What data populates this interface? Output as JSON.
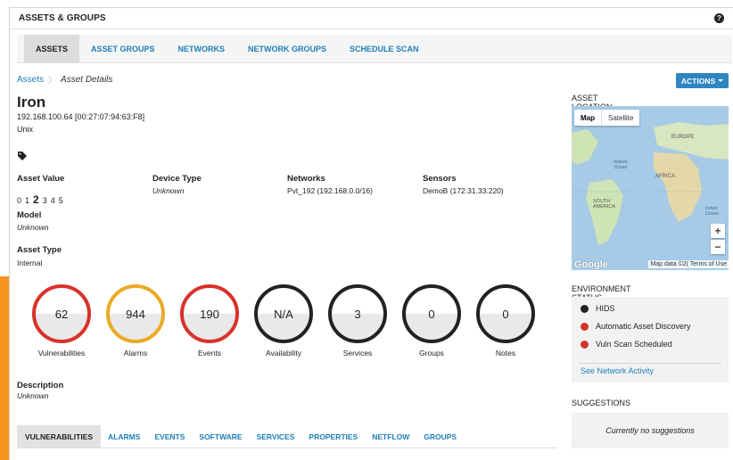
{
  "header": {
    "title": "ASSETS & GROUPS",
    "help_glyph": "?"
  },
  "tabs": [
    {
      "label": "ASSETS",
      "active": true
    },
    {
      "label": "ASSET GROUPS",
      "active": false
    },
    {
      "label": "NETWORKS",
      "active": false
    },
    {
      "label": "NETWORK GROUPS",
      "active": false
    },
    {
      "label": "SCHEDULE SCAN",
      "active": false
    }
  ],
  "breadcrumb": {
    "root": "Assets",
    "separator": "〉",
    "current": "Asset Details"
  },
  "actions": {
    "label": "ACTIONS"
  },
  "asset": {
    "name": "Iron",
    "ip_mac": "192.168.100.64 [00:27:07:94:63:F8]",
    "os": "Unix",
    "tag_icon": "tag-icon"
  },
  "fields": {
    "asset_value": {
      "label": "Asset Value",
      "scale": [
        "0",
        "1",
        "2",
        "3",
        "4",
        "5"
      ],
      "selected": "2"
    },
    "device_type": {
      "label": "Device Type",
      "value": "Unknown"
    },
    "networks": {
      "label": "Networks",
      "value": "Pvt_192 (192.168.0.0/16)"
    },
    "sensors": {
      "label": "Sensors",
      "value": "DemoB (172.31.33.220)"
    },
    "model": {
      "label": "Model",
      "value": "Unknown"
    },
    "asset_type": {
      "label": "Asset Type",
      "value": "Internal"
    }
  },
  "metrics": [
    {
      "value": "62",
      "label": "Vulnerabilities",
      "color": "#d9322b"
    },
    {
      "value": "944",
      "label": "Alarms",
      "color": "#eaaa25"
    },
    {
      "value": "190",
      "label": "Events",
      "color": "#d9322b"
    },
    {
      "value": "N/A",
      "label": "Availability",
      "color": "#222222"
    },
    {
      "value": "3",
      "label": "Services",
      "color": "#222222"
    },
    {
      "value": "0",
      "label": "Groups",
      "color": "#222222"
    },
    {
      "value": "0",
      "label": "Notes",
      "color": "#222222"
    }
  ],
  "description": {
    "label": "Description",
    "value": "Unknown"
  },
  "bottom_tabs": [
    {
      "label": "VULNERABILITIES",
      "active": true
    },
    {
      "label": "ALARMS",
      "active": false
    },
    {
      "label": "EVENTS",
      "active": false
    },
    {
      "label": "SOFTWARE",
      "active": false
    },
    {
      "label": "SERVICES",
      "active": false
    },
    {
      "label": "PROPERTIES",
      "active": false
    },
    {
      "label": "NETFLOW",
      "active": false
    },
    {
      "label": "GROUPS",
      "active": false
    }
  ],
  "location": {
    "title": "ASSET LOCATION",
    "map_btn": "Map",
    "satellite_btn": "Satellite",
    "labels": {
      "europe": "EUROPE",
      "africa": "AFRICA",
      "south_america": "SOUTH AMERICA",
      "atlantic": "Atlantic Ocean",
      "indian": "Indian Ocean"
    },
    "zoom_in": "+",
    "zoom_out": "−",
    "google": "Google",
    "attribution": "Map data ©2( Terms of Use"
  },
  "environment": {
    "title": "ENVIRONMENT STATUS",
    "items": [
      {
        "label": "HIDS",
        "color": "#222222"
      },
      {
        "label": "Automatic Asset Discovery",
        "color": "#d9322b"
      },
      {
        "label": "Vuln Scan Scheduled",
        "color": "#d9322b"
      }
    ],
    "link": "See Network Activity"
  },
  "suggestions": {
    "title": "SUGGESTIONS",
    "empty": "Currently no suggestions"
  }
}
